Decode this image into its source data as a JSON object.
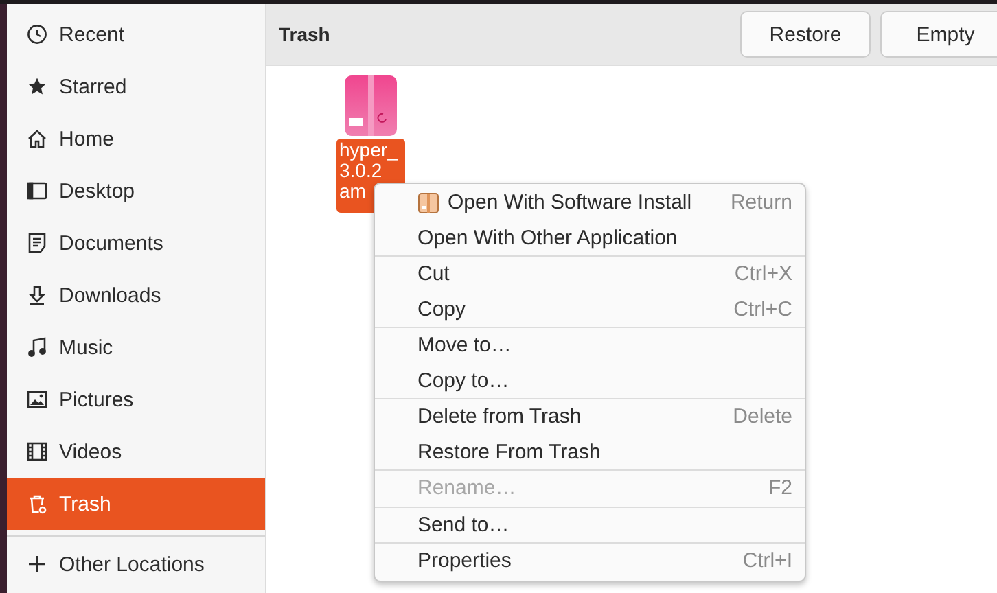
{
  "sidebar": {
    "items": [
      {
        "label": "Recent",
        "selected": false
      },
      {
        "label": "Starred",
        "selected": false
      },
      {
        "label": "Home",
        "selected": false
      },
      {
        "label": "Desktop",
        "selected": false
      },
      {
        "label": "Documents",
        "selected": false
      },
      {
        "label": "Downloads",
        "selected": false
      },
      {
        "label": "Music",
        "selected": false
      },
      {
        "label": "Pictures",
        "selected": false
      },
      {
        "label": "Videos",
        "selected": false
      },
      {
        "label": "Trash",
        "selected": true
      }
    ],
    "other": "Other Locations"
  },
  "header": {
    "title": "Trash",
    "buttons": [
      "Restore",
      "Empty"
    ]
  },
  "file": {
    "name_lines": [
      "hyper_",
      "3.0.2",
      "am"
    ],
    "selected": true
  },
  "context_menu": {
    "groups": [
      [
        {
          "kind": "icon",
          "label": "Open With Software Install",
          "shortcut": "Return",
          "disabled": false
        },
        {
          "kind": "text",
          "label": "Open With Other Application",
          "disabled": false
        }
      ],
      [
        {
          "kind": "text",
          "label": "Cut",
          "shortcut": "Ctrl+X",
          "disabled": false
        },
        {
          "kind": "text",
          "label": "Copy",
          "shortcut": "Ctrl+C",
          "disabled": false
        }
      ],
      [
        {
          "kind": "text",
          "label": "Move to…",
          "disabled": false
        },
        {
          "kind": "text",
          "label": "Copy to…",
          "disabled": false
        }
      ],
      [
        {
          "kind": "text",
          "label": "Delete from Trash",
          "shortcut": "Delete",
          "disabled": false
        },
        {
          "kind": "text",
          "label": "Restore From Trash",
          "disabled": false
        }
      ],
      [
        {
          "kind": "text",
          "label": "Rename…",
          "shortcut": "F2",
          "disabled": true
        }
      ],
      [
        {
          "kind": "text",
          "label": "Send to…",
          "disabled": false
        }
      ],
      [
        {
          "kind": "text",
          "label": "Properties",
          "shortcut": "Ctrl+I",
          "disabled": false
        }
      ]
    ]
  }
}
